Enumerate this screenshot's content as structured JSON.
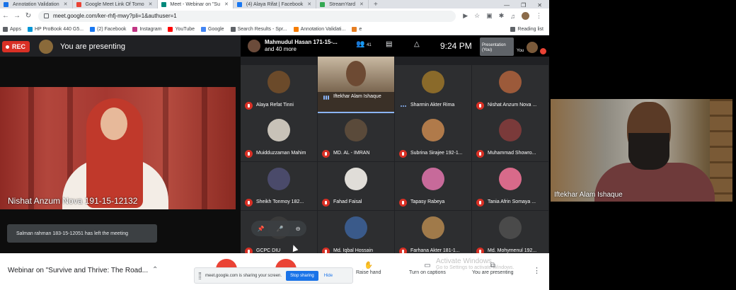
{
  "tabs": [
    {
      "label": "Annotation Validation",
      "color": "#1a73e8"
    },
    {
      "label": "Google Meet Link Of Tomo",
      "color": "#ea4335"
    },
    {
      "label": "Meet - Webinar on \"Su",
      "color": "#00897b",
      "active": true
    },
    {
      "label": "(4) Alaya Rifat | Facebook",
      "color": "#1877f2"
    },
    {
      "label": "StreamYard",
      "color": "#34a853"
    }
  ],
  "address": {
    "url": "meet.google.com/ker-rhfj-mwy?pli=1&authuser=1"
  },
  "bookmarks": [
    {
      "label": "Apps",
      "color": "#5f6368"
    },
    {
      "label": "HP ProBook 440 G5...",
      "color": "#0096d6"
    },
    {
      "label": "(2) Facebook",
      "color": "#1877f2"
    },
    {
      "label": "Instagram",
      "color": "#c13584"
    },
    {
      "label": "YouTube",
      "color": "#ff0000"
    },
    {
      "label": "Google",
      "color": "#4285f4"
    },
    {
      "label": "Search Results - Spr...",
      "color": "#5f6368"
    },
    {
      "label": "Annotation Validati...",
      "color": "#f57c00"
    },
    {
      "label": "e",
      "color": "#e67e22"
    }
  ],
  "reading_list": "Reading list",
  "meet": {
    "rec_label": "REC",
    "presenting_text": "You are presenting",
    "presenter_chip_line1": "Mahmudul Hasan 171-15-...",
    "presenter_chip_line2": "and 40 more",
    "participant_count": "41",
    "time": "9:24 PM",
    "self_tile_label": "Presentation (You)",
    "you_label": "You",
    "spotlight_name": "Nishat Anzum Nova 191-15-12132",
    "toast": "Salman rahman 183-15-12051 has left the meeting",
    "meeting_title": "Webinar on \"Survive and Thrive: The Road...",
    "share_text": "meet.google.com is sharing your screen.",
    "stop_sharing": "Stop sharing",
    "hide": "Hide",
    "raise_hand": "Raise hand",
    "turn_on_captions": "Turn on captions",
    "you_are_presenting": "You are presenting",
    "watermark_line1": "Activate Windows",
    "watermark_line2": "Go to Settings to activate Windows."
  },
  "participants": [
    {
      "name": "Alaya Refat Tinni",
      "avatar_color": "#6b4a2a",
      "mic": "muted"
    },
    {
      "name": "Iftekhar Alam Ishaque",
      "avatar_color": "#6d4a33",
      "mic": "speaking",
      "video": true
    },
    {
      "name": "Sharmin Akter Rima",
      "avatar_color": "#8a6a2a",
      "mic": "dots"
    },
    {
      "name": "Nishat Anzum Nova ...",
      "avatar_color": "#9c5a3a",
      "mic": "muted"
    },
    {
      "name": "Muidduzzaman Mahim",
      "avatar_color": "#c8c2b8",
      "mic": "muted"
    },
    {
      "name": "MD. AL - IMRAN",
      "avatar_color": "#5a4a3a",
      "mic": "muted"
    },
    {
      "name": "Subrina Sirajee 192-1...",
      "avatar_color": "#b07a4a",
      "mic": "muted"
    },
    {
      "name": "Muhammad Showro...",
      "avatar_color": "#7a3a3a",
      "mic": "muted"
    },
    {
      "name": "Sheikh Tonmoy 182...",
      "avatar_color": "#4a4a6a",
      "mic": "muted"
    },
    {
      "name": "Fahad Faisal",
      "avatar_color": "#e0ddd8",
      "mic": "muted"
    },
    {
      "name": "Tapasy Rabeya",
      "avatar_color": "#c76a9a",
      "mic": "muted"
    },
    {
      "name": "Tania Afrin Somaya ...",
      "avatar_color": "#d86a8a",
      "mic": "muted"
    },
    {
      "name": "GCPC DIU",
      "avatar_color": "#3a3a3a",
      "mic": "muted"
    },
    {
      "name": "Md. Iqbal Hossain",
      "avatar_color": "#3a5a8a",
      "mic": "muted"
    },
    {
      "name": "Farhana Akter 181-1...",
      "avatar_color": "#a07a4a",
      "mic": "muted"
    },
    {
      "name": "Md. Mohymenul 192...",
      "avatar_color": "#4a4a4a",
      "mic": "muted"
    }
  ],
  "webcam": {
    "name": "Iftekhar Alam Ishaque"
  },
  "icons": {
    "people": "people-icon",
    "chat": "chat-icon",
    "activities": "activities-icon",
    "raise_hand": "hand-icon",
    "captions": "captions-icon",
    "present": "present-icon",
    "more": "more-vert-icon"
  }
}
